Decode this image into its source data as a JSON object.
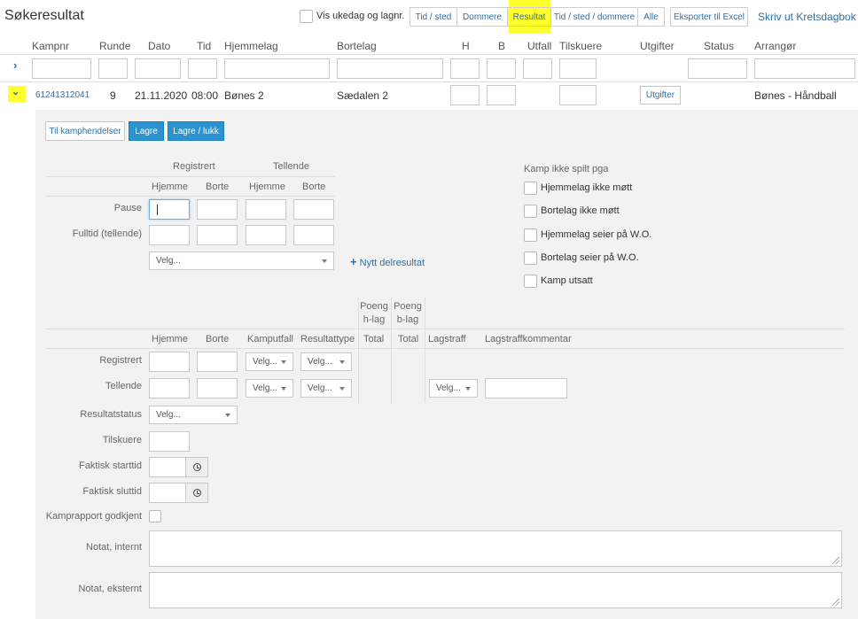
{
  "header": {
    "title": "Søkeresultat",
    "show_weekday_label": "Vis ukedag og lagnr.",
    "view_tabs": [
      "Tid / sted",
      "Dommere",
      "Resultat",
      "Tid / sted / dommere",
      "Alle"
    ],
    "active_tab": "Resultat",
    "export_label": "Eksporter til Excel",
    "print_label": "Skriv ut Kretsdagbok"
  },
  "table": {
    "columns": [
      "Kampnr",
      "Runde",
      "Dato",
      "Tid",
      "Hjemmelag",
      "Bortelag",
      "H",
      "B",
      "Utfall",
      "Tilskuere",
      "Utgifter",
      "Status",
      "Arrangør"
    ],
    "match": {
      "kampnr": "61241312041",
      "runde": "9",
      "dato": "21.11.2020",
      "tid": "08:00",
      "hjemmelag": "Bønes 2",
      "bortelag": "Sædalen 2",
      "utgifter_button": "Utgifter",
      "arrangor": "Bønes - Håndball"
    }
  },
  "detail": {
    "buttons": {
      "events": "Til kamphendelser",
      "save": "Lagre",
      "save_close": "Lagre / lukk"
    },
    "score": {
      "group_registered": "Registrert",
      "group_counting": "Tellende",
      "home": "Hjemme",
      "away": "Borte",
      "row_pause": "Pause",
      "row_fulltime": "Fulltid (tellende)",
      "select_placeholder": "Velg...",
      "new_partial": "Nytt delresultat"
    },
    "not_played": {
      "title": "Kamp ikke spilt pga",
      "options": [
        "Hjemmelag ikke møtt",
        "Bortelag ikke møtt",
        "Hjemmelag seier på W.O.",
        "Bortelag seier på W.O.",
        "Kamp utsatt"
      ]
    },
    "points": {
      "poeng_h": "Poeng",
      "poeng_h2": "h-lag",
      "poeng_b": "Poeng",
      "poeng_b2": "b-lag",
      "cols": [
        "Hjemme",
        "Borte",
        "Kamputfall",
        "Resultattype",
        "Total",
        "Total",
        "Lagstraff",
        "Lagstraffkommentar"
      ],
      "row_registered": "Registrert",
      "row_counting": "Tellende",
      "small_select": "Velg..."
    },
    "result_status_label": "Resultatstatus",
    "result_status_select": "Velg...",
    "spectators_label": "Tilskuere",
    "actual_start_label": "Faktisk starttid",
    "actual_end_label": "Faktisk sluttid",
    "report_approved_label": "Kamprapport godkjent",
    "note_internal_label": "Notat, internt",
    "note_external_label": "Notat, eksternt"
  },
  "colors": {
    "highlight": "#ffff2b",
    "primary": "#2b94cf",
    "link": "#2f6fa7"
  }
}
